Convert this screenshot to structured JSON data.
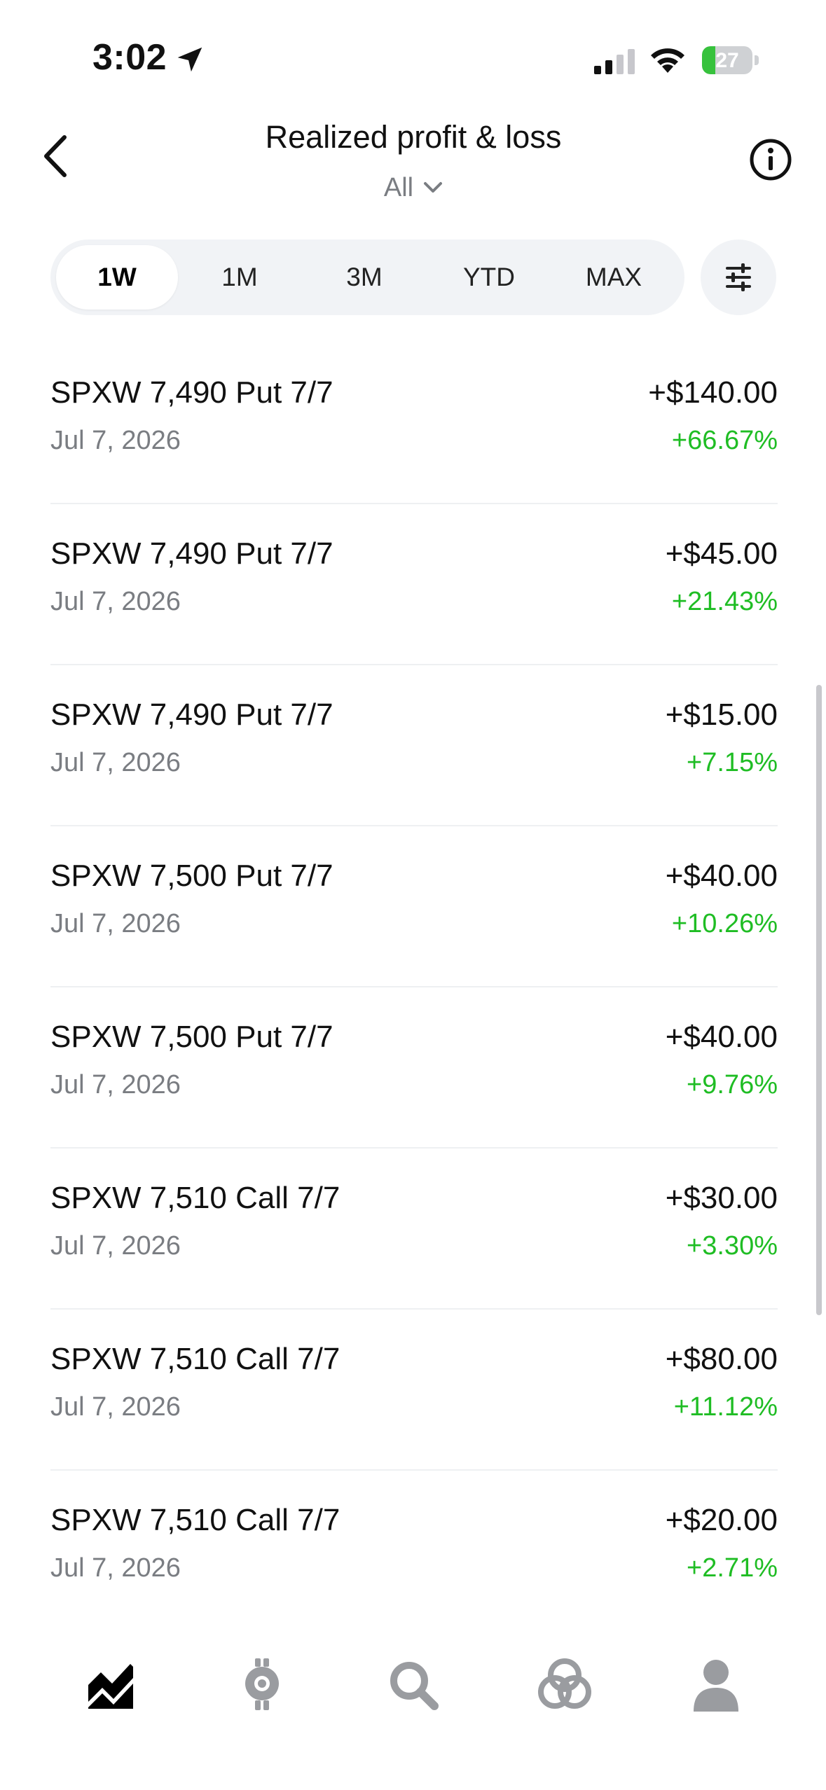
{
  "status_bar": {
    "time": "3:02",
    "battery_percent": "27",
    "battery_level": 0.27
  },
  "header": {
    "title": "Realized profit & loss",
    "filter_value": "All"
  },
  "timeframes": [
    {
      "label": "1W",
      "active": true
    },
    {
      "label": "1M",
      "active": false
    },
    {
      "label": "3M",
      "active": false
    },
    {
      "label": "YTD",
      "active": false
    },
    {
      "label": "MAX",
      "active": false
    }
  ],
  "trades": [
    {
      "name": "SPXW 7,490 Put 7/7",
      "date": "Jul 7, 2026",
      "amount": "+$140.00",
      "percent": "+66.67%"
    },
    {
      "name": "SPXW 7,490 Put 7/7",
      "date": "Jul 7, 2026",
      "amount": "+$45.00",
      "percent": "+21.43%"
    },
    {
      "name": "SPXW 7,490 Put 7/7",
      "date": "Jul 7, 2026",
      "amount": "+$15.00",
      "percent": "+7.15%"
    },
    {
      "name": "SPXW 7,500 Put 7/7",
      "date": "Jul 7, 2026",
      "amount": "+$40.00",
      "percent": "+10.26%"
    },
    {
      "name": "SPXW 7,500 Put 7/7",
      "date": "Jul 7, 2026",
      "amount": "+$40.00",
      "percent": "+9.76%"
    },
    {
      "name": "SPXW 7,510 Call 7/7",
      "date": "Jul 7, 2026",
      "amount": "+$30.00",
      "percent": "+3.30%"
    },
    {
      "name": "SPXW 7,510 Call 7/7",
      "date": "Jul 7, 2026",
      "amount": "+$80.00",
      "percent": "+11.12%"
    },
    {
      "name": "SPXW 7,510 Call 7/7",
      "date": "Jul 7, 2026",
      "amount": "+$20.00",
      "percent": "+2.71%"
    }
  ],
  "bottom_nav": [
    {
      "icon": "chart-icon",
      "active": true
    },
    {
      "icon": "lightbulb-icon",
      "active": false
    },
    {
      "icon": "search-icon",
      "active": false
    },
    {
      "icon": "network-icon",
      "active": false
    },
    {
      "icon": "person-icon",
      "active": false
    }
  ],
  "colors": {
    "positive": "#1fbd24",
    "secondary_text": "#7a7d82",
    "segment_bg": "#f1f3f6",
    "battery_green": "#37c23d"
  }
}
